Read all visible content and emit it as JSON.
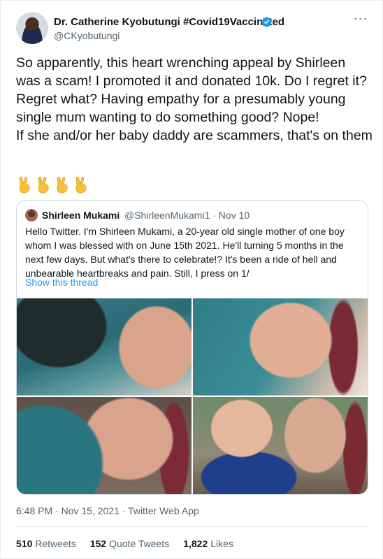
{
  "author": {
    "name": "Dr. Catherine Kyobutungi #Covid19Vaccinated",
    "handle": "@CKyobutungi",
    "verified_color": "#1d9bf0"
  },
  "tweet": {
    "paragraphs": [
      "So apparently, this heart wrenching appeal by Shirleen was a scam! I promoted it and donated 10k. Do I regret it? Regret what? Having empathy for a presumably young single mum wanting to do something good? Nope!",
      "If she and/or her baby daddy are scammers, that's on them"
    ],
    "emojis": [
      "victory-hand-icon",
      "victory-hand-icon",
      "victory-hand-icon",
      "victory-hand-icon"
    ]
  },
  "quoted": {
    "name": "Shirleen Mukami",
    "handle_date": "@ShirleenMukami1 · Nov 10",
    "text": "Hello Twitter. I'm Shirleen Mukami, a 20-year old single mother of one boy whom I was blessed with on June 15th 2021. He'll turning 5 months in the next few days. But what's there to celebrate!? It's been a ride of hell and unbearable heartbreaks and pain. Still, I press on 1/",
    "thread_link": "Show this thread"
  },
  "meta": {
    "timestamp": "6:48 PM · Nov 15, 2021 · Twitter Web App"
  },
  "stats": {
    "retweets_count": "510",
    "retweets_label": "Retweets",
    "quotes_count": "152",
    "quotes_label": "Quote Tweets",
    "likes_count": "1,822",
    "likes_label": "Likes"
  },
  "colors": {
    "link": "#1d9bf0",
    "secondary_text": "#536471",
    "border": "#cfd9de"
  }
}
